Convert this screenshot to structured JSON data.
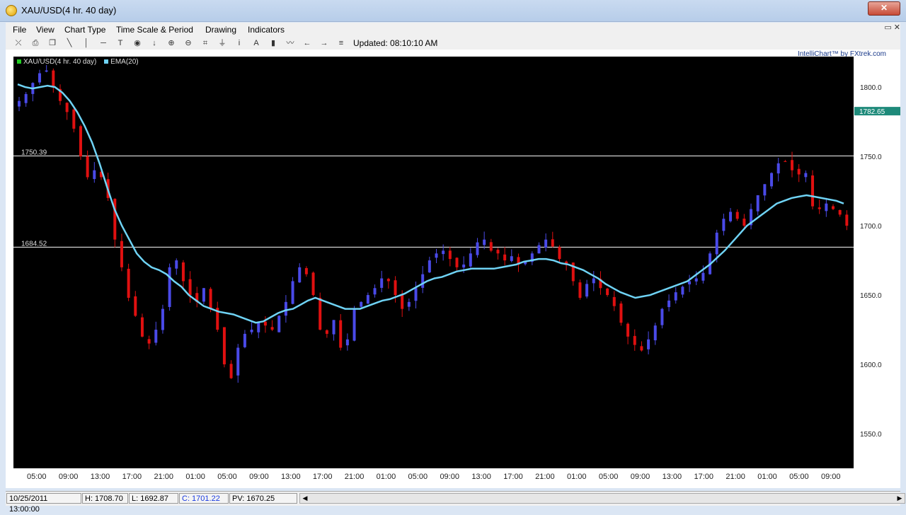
{
  "window": {
    "title": "XAU/USD(4 hr.  40 day)",
    "close_glyph": "✕"
  },
  "menu": [
    "File",
    "View",
    "Chart Type",
    "Time Scale & Period",
    "Drawing",
    "Indicators"
  ],
  "mdi_buttons": "▭ ✕",
  "toolbar": {
    "icons": [
      "crosshair-icon",
      "print-icon",
      "copy-icon",
      "trendline-icon",
      "vertical-line-icon",
      "horizontal-line-icon",
      "text-icon",
      "marker-icon",
      "down-arrow-icon",
      "zoom-in-icon",
      "zoom-out-icon",
      "fit-icon",
      "anchor-icon",
      "info-icon",
      "letter-a-icon",
      "bar-chart-icon",
      "wave-icon",
      "scroll-left-icon",
      "scroll-right-icon",
      "options-icon"
    ],
    "glyphs": [
      "⤫",
      "⎙",
      "❐",
      "╲",
      "│",
      "─",
      "T",
      "◉",
      "↓",
      "⊕",
      "⊖",
      "⌗",
      "⏚",
      "i",
      "A",
      "▮",
      "〰",
      "←",
      "→",
      "≡"
    ],
    "updated": "Updated: 08:10:10 AM"
  },
  "brand": "IntelliChart™ by FXtrek.com",
  "legend": [
    {
      "label": "XAU/USD(4 hr.  40 day)",
      "color": "#22cc22"
    },
    {
      "label": "EMA(20)",
      "color": "#6fd3f5"
    }
  ],
  "price_labels": [
    {
      "text": "1800.0",
      "value": 1800
    },
    {
      "text": "1750.0",
      "value": 1750
    },
    {
      "text": "1700.0",
      "value": 1700
    },
    {
      "text": "1650.0",
      "value": 1650
    },
    {
      "text": "1600.0",
      "value": 1600
    },
    {
      "text": "1550.0",
      "value": 1550
    }
  ],
  "current_price": {
    "text": "1782.65",
    "value": 1782.65
  },
  "hlines": [
    {
      "text": "1750.39",
      "value": 1750.39
    },
    {
      "text": "1684.52",
      "value": 1684.52
    }
  ],
  "time_labels": [
    "05:00",
    "09:00",
    "13:00",
    "17:00",
    "21:00",
    "01:00",
    "05:00",
    "09:00",
    "13:00",
    "17:00",
    "21:00",
    "01:00",
    "05:00",
    "09:00",
    "13:00",
    "17:00",
    "21:00",
    "01:00",
    "05:00",
    "09:00",
    "13:00",
    "17:00",
    "21:00",
    "01:00",
    "05:00",
    "09:00"
  ],
  "status": {
    "date": "10/25/2011 13:00:00",
    "high": "H: 1708.70",
    "low": "L: 1692.87",
    "close": "C: 1701.22",
    "pv": "PV: 1670.25"
  },
  "colors": {
    "up": "#4a4ae8",
    "down": "#e01010",
    "ema": "#6fd3f5",
    "hline": "#ffffff"
  },
  "chart_data": {
    "type": "line",
    "ylim": [
      1525,
      1822
    ],
    "close_series": [
      1790,
      1795,
      1803,
      1810,
      1812,
      1800,
      1790,
      1782,
      1770,
      1750,
      1735,
      1740,
      1735,
      1720,
      1690,
      1670,
      1648,
      1635,
      1620,
      1615,
      1625,
      1640,
      1670,
      1675,
      1660,
      1650,
      1645,
      1655,
      1640,
      1625,
      1600,
      1590,
      1612,
      1622,
      1625,
      1630,
      1628,
      1625,
      1635,
      1645,
      1660,
      1670,
      1665,
      1650,
      1625,
      1622,
      1632,
      1612,
      1618,
      1640,
      1645,
      1650,
      1655,
      1662,
      1660,
      1650,
      1640,
      1645,
      1655,
      1665,
      1675,
      1680,
      1682,
      1676,
      1670,
      1672,
      1680,
      1688,
      1690,
      1682,
      1680,
      1675,
      1678,
      1672,
      1674,
      1680,
      1686,
      1690,
      1685,
      1676,
      1672,
      1660,
      1648,
      1658,
      1662,
      1655,
      1650,
      1642,
      1630,
      1620,
      1614,
      1610,
      1618,
      1628,
      1640,
      1646,
      1652,
      1656,
      1660,
      1662,
      1666,
      1680,
      1695,
      1705,
      1710,
      1705,
      1700,
      1712,
      1722,
      1730,
      1738,
      1745,
      1746,
      1740,
      1737,
      1738,
      1714,
      1712,
      1716,
      1712,
      1708,
      1700
    ],
    "ema20": [
      1802,
      1800,
      1799,
      1800,
      1801,
      1800,
      1796,
      1790,
      1782,
      1772,
      1760,
      1745,
      1728,
      1712,
      1700,
      1690,
      1680,
      1674,
      1670,
      1668,
      1665,
      1660,
      1656,
      1650,
      1646,
      1642,
      1640,
      1638,
      1637,
      1636,
      1634,
      1632,
      1630,
      1631,
      1634,
      1637,
      1639,
      1640,
      1643,
      1646,
      1648,
      1646,
      1644,
      1642,
      1640,
      1640,
      1640,
      1642,
      1644,
      1646,
      1647,
      1649,
      1651,
      1654,
      1657,
      1660,
      1662,
      1663,
      1665,
      1667,
      1668,
      1669,
      1669,
      1669,
      1669,
      1670,
      1671,
      1672,
      1674,
      1675,
      1676,
      1676,
      1675,
      1673,
      1672,
      1670,
      1668,
      1665,
      1662,
      1658,
      1655,
      1652,
      1650,
      1648,
      1649,
      1650,
      1652,
      1654,
      1656,
      1658,
      1660,
      1664,
      1668,
      1672,
      1677,
      1682,
      1688,
      1694,
      1700,
      1704,
      1708,
      1712,
      1716,
      1718,
      1720,
      1721,
      1722,
      1721,
      1720,
      1719,
      1718,
      1716
    ]
  }
}
